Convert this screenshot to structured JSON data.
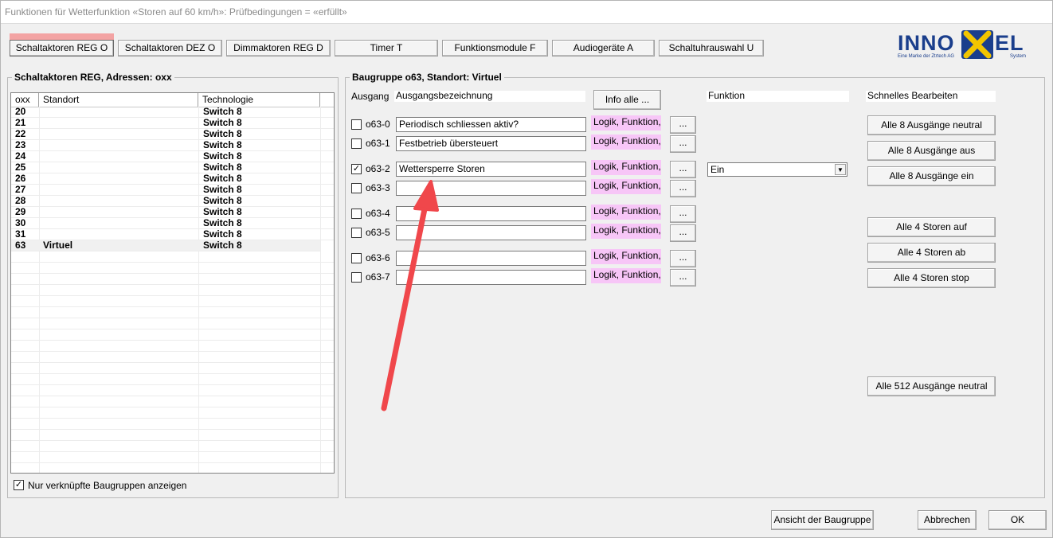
{
  "window": {
    "title": "Funktionen für Wetterfunktion «Storen auf 60 km/h»: Prüfbedingungen = «erfüllt»"
  },
  "tabs": [
    "Schaltaktoren REG O",
    "Schaltaktoren DEZ O",
    "Dimmaktoren REG D",
    "Timer T",
    "Funktionsmodule F",
    "Audiogeräte A",
    "Schaltuhrauswahl U"
  ],
  "logo": {
    "text_left": "INNO",
    "text_right": "EL",
    "tagline": "Eine Marke der Ztrtech AG",
    "system": "System",
    "accent": "#f2c500",
    "brand": "#1a3e8c"
  },
  "left_panel": {
    "title": "Schaltaktoren REG, Adressen: oxx",
    "columns": [
      "oxx",
      "Standort",
      "Technologie"
    ],
    "rows": [
      {
        "oxx": "20",
        "standort": "",
        "tech": "Switch 8"
      },
      {
        "oxx": "21",
        "standort": "",
        "tech": "Switch 8"
      },
      {
        "oxx": "22",
        "standort": "",
        "tech": "Switch 8"
      },
      {
        "oxx": "23",
        "standort": "",
        "tech": "Switch 8"
      },
      {
        "oxx": "24",
        "standort": "",
        "tech": "Switch 8"
      },
      {
        "oxx": "25",
        "standort": "",
        "tech": "Switch 8"
      },
      {
        "oxx": "26",
        "standort": "",
        "tech": "Switch 8"
      },
      {
        "oxx": "27",
        "standort": "",
        "tech": "Switch 8"
      },
      {
        "oxx": "28",
        "standort": "",
        "tech": "Switch 8"
      },
      {
        "oxx": "29",
        "standort": "",
        "tech": "Switch 8"
      },
      {
        "oxx": "30",
        "standort": "",
        "tech": "Switch 8"
      },
      {
        "oxx": "31",
        "standort": "",
        "tech": "Switch 8"
      },
      {
        "oxx": "63",
        "standort": "Virtuel",
        "tech": "Switch 8"
      }
    ],
    "filter_label": "Nur verknüpfte Baugruppen anzeigen",
    "filter_checked": true
  },
  "right_panel": {
    "title": "Baugruppe o63, Standort: Virtuel",
    "col_ausgang": "Ausgang",
    "col_bezeichnung": "Ausgangsbezeichnung",
    "info_button": "Info alle ...",
    "col_funktion": "Funktion",
    "col_schnell": "Schnelles Bearbeiten",
    "outputs": [
      {
        "id": "o63-0",
        "name": "Periodisch schliessen aktiv?",
        "logic": "Logik, Funktion, V",
        "checked": false
      },
      {
        "id": "o63-1",
        "name": "Festbetrieb übersteuert",
        "logic": "Logik, Funktion, V",
        "checked": false
      },
      {
        "id": "o63-2",
        "name": "Wettersperre Storen",
        "logic": "Logik, Funktion, V",
        "checked": true
      },
      {
        "id": "o63-3",
        "name": "",
        "logic": "Logik, Funktion, V",
        "checked": false
      },
      {
        "id": "o63-4",
        "name": "",
        "logic": "Logik, Funktion, V",
        "checked": false
      },
      {
        "id": "o63-5",
        "name": "",
        "logic": "Logik, Funktion, V",
        "checked": false
      },
      {
        "id": "o63-6",
        "name": "",
        "logic": "Logik, Funktion, V",
        "checked": false
      },
      {
        "id": "o63-7",
        "name": "",
        "logic": "Logik, Funktion, V",
        "checked": false
      }
    ],
    "dots_label": "...",
    "function_select": "Ein",
    "quick_buttons": [
      "Alle 8 Ausgänge neutral",
      "Alle 8 Ausgänge aus",
      "Alle 8 Ausgänge ein",
      "Alle 4 Storen auf",
      "Alle 4 Storen ab",
      "Alle 4 Storen stop",
      "Alle 512 Ausgänge neutral"
    ]
  },
  "footer": {
    "view_button": "Ansicht der Baugruppe",
    "cancel_button": "Abbrechen",
    "ok_button": "OK"
  },
  "colors": {
    "logic_bg": "#f7c6f7",
    "arrow": "#f0474b",
    "tab_marker": "#f3a3a3"
  }
}
